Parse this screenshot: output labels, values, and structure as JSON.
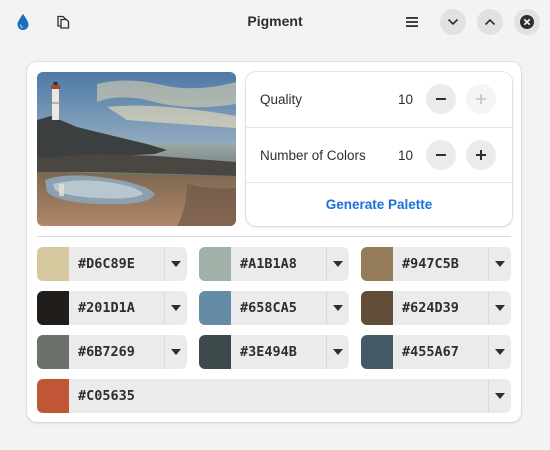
{
  "window": {
    "title": "Pigment"
  },
  "controls": {
    "quality": {
      "label": "Quality",
      "value": "10"
    },
    "num_colors": {
      "label": "Number of Colors",
      "value": "10"
    },
    "generate_label": "Generate Palette"
  },
  "palette": [
    {
      "hex": "#D6C89E"
    },
    {
      "hex": "#A1B1A8"
    },
    {
      "hex": "#947C5B"
    },
    {
      "hex": "#201D1A"
    },
    {
      "hex": "#658CA5"
    },
    {
      "hex": "#624D39"
    },
    {
      "hex": "#6B7269"
    },
    {
      "hex": "#3E494B"
    },
    {
      "hex": "#455A67"
    },
    {
      "hex": "#C05635"
    }
  ],
  "colors": {
    "accent": "#1c71d8"
  }
}
